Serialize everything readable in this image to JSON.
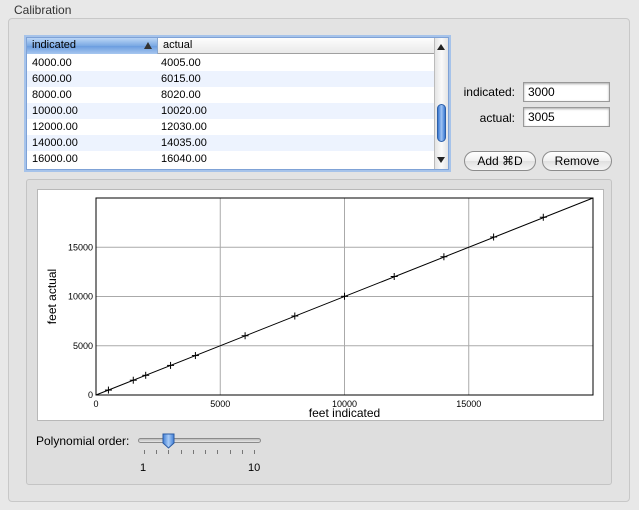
{
  "group": {
    "title": "Calibration"
  },
  "table": {
    "columns": [
      "indicated",
      "actual"
    ],
    "sorted_column": "indicated",
    "rows": [
      [
        "4000.00",
        "4005.00"
      ],
      [
        "6000.00",
        "6015.00"
      ],
      [
        "8000.00",
        "8020.00"
      ],
      [
        "10000.00",
        "10020.00"
      ],
      [
        "12000.00",
        "12030.00"
      ],
      [
        "14000.00",
        "14035.00"
      ],
      [
        "16000.00",
        "16040.00"
      ]
    ]
  },
  "form": {
    "indicated_label": "indicated:",
    "indicated_value": "3000",
    "actual_label": "actual:",
    "actual_value": "3005",
    "add_label": "Add  ⌘D",
    "remove_label": "Remove"
  },
  "slider": {
    "label": "Polynomial order:",
    "min_label": "1",
    "max_label": "10",
    "min": 1,
    "max": 10,
    "value": 3
  },
  "chart_data": {
    "type": "scatter",
    "title": "",
    "xlabel": "feet indicated",
    "ylabel": "feet actual",
    "xlim": [
      0,
      20000
    ],
    "ylim": [
      0,
      20000
    ],
    "xticks": [
      0,
      5000,
      10000,
      15000
    ],
    "yticks": [
      0,
      5000,
      10000,
      15000
    ],
    "grid": true,
    "points": {
      "x": [
        500,
        1500,
        2000,
        3000,
        4000,
        6000,
        8000,
        10000,
        12000,
        14000,
        16000,
        18000
      ],
      "y": [
        500,
        1500,
        2000,
        3005,
        4005,
        6015,
        8020,
        10020,
        12030,
        14035,
        16040,
        18045
      ]
    },
    "fit_line": {
      "x": [
        0,
        20000
      ],
      "y": [
        0,
        20000
      ]
    }
  }
}
